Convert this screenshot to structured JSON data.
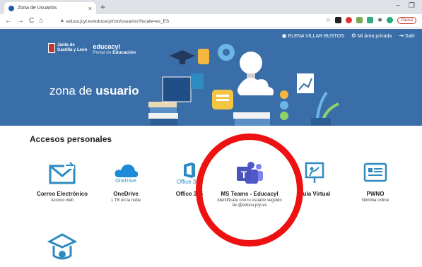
{
  "browser": {
    "tab_title": "Zona de Usuarios",
    "tab_close": "×",
    "new_tab": "+",
    "url": "educa.jcyl.es/educacyl/cm/usuarios?locale=es_ES",
    "window_min": "−",
    "window_restore": "❐",
    "pause_label": "Pausa"
  },
  "header": {
    "user_name": "ELENA VILLAR BUSTOS",
    "private_area": "Mi área privada",
    "logout": "Salir",
    "logo_line1": "Junta de",
    "logo_line2": "Castilla y León",
    "brand": "educacyl",
    "portal_prefix": "Portal de ",
    "portal_bold": "Educación",
    "zona_prefix": "zona de ",
    "zona_bold": "usuario"
  },
  "section": {
    "title": "Accesos personales"
  },
  "apps": [
    {
      "name": "Correo Electrónico",
      "sub": "Acceso web",
      "icon": "mail-icon"
    },
    {
      "name": "OneDrive",
      "sub": "1 TB en la nube",
      "icon": "onedrive-icon",
      "icon_text": "OneDrive"
    },
    {
      "name": "Office 365",
      "sub": "",
      "icon": "office-icon",
      "icon_text": "Office 365"
    },
    {
      "name": "MS Teams - Educacyl",
      "sub": "Identifícate con tu usuario seguido de @educa.jcyl.es",
      "icon": "teams-icon"
    },
    {
      "name": "Aula Virtual",
      "sub": "",
      "icon": "aula-virtual-icon"
    },
    {
      "name": "PWNO",
      "sub": "Nómina online",
      "icon": "pwno-icon"
    }
  ],
  "colors": {
    "banner": "#3a6ea8",
    "accent_blue": "#2e8bc0",
    "teams": "#5059c9",
    "highlight": "#ee1111"
  }
}
